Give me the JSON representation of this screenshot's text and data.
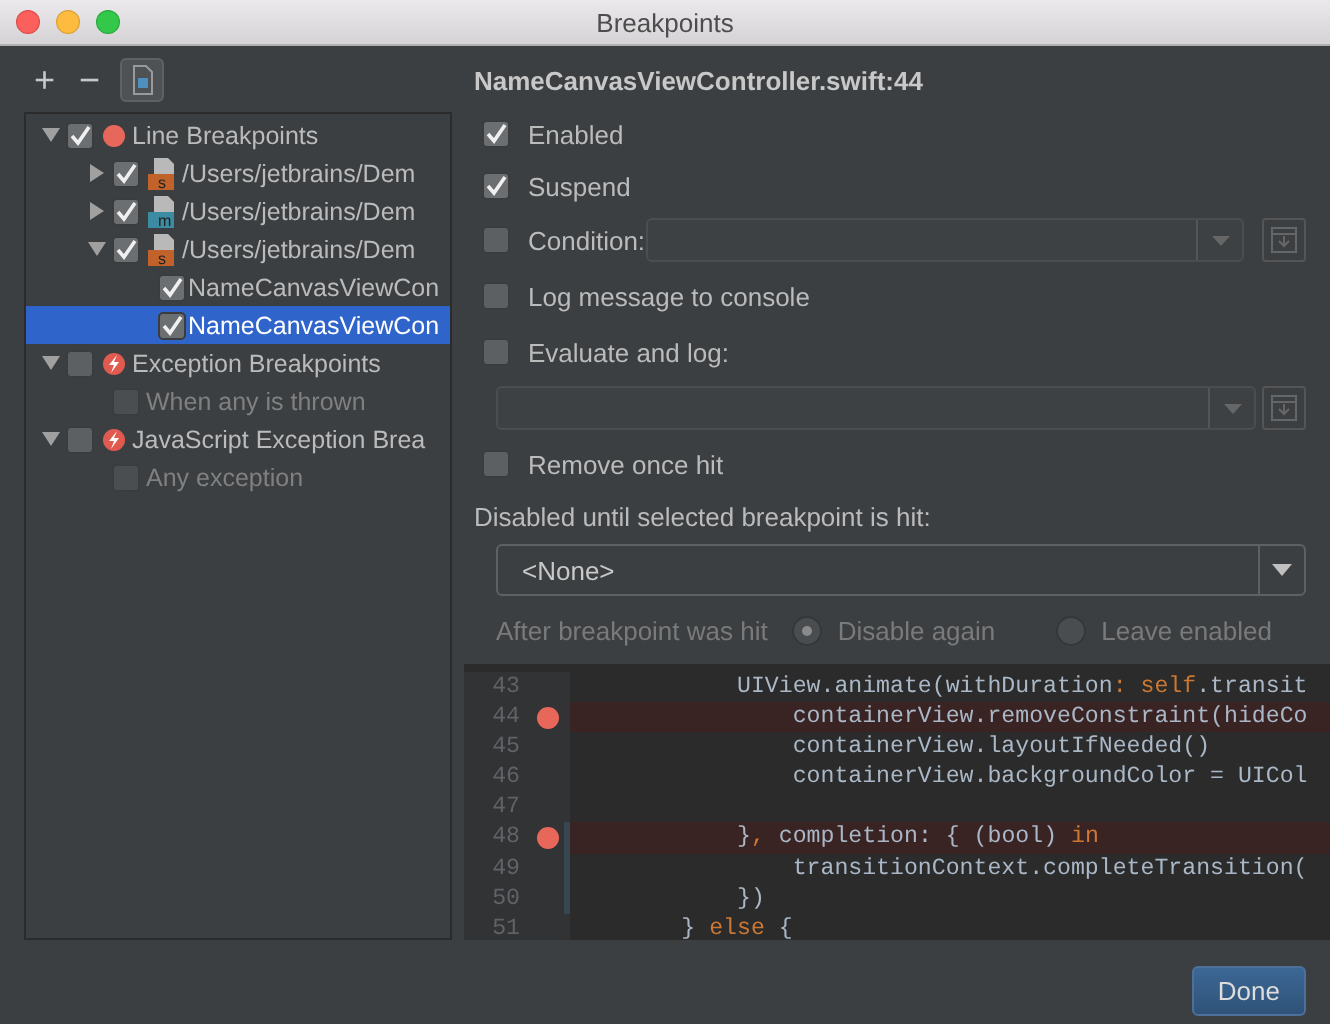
{
  "window": {
    "title": "Breakpoints"
  },
  "toolbar": [
    {
      "kind": "add",
      "label": "+"
    },
    {
      "kind": "remove",
      "label": "−"
    },
    {
      "kind": "group",
      "selected": true
    }
  ],
  "tree": [
    {
      "kind": "line-group",
      "label": "Line Breakpoints",
      "checked": true,
      "expanded": true,
      "selected": false,
      "disabled": false,
      "children": [
        {
          "kind": "file",
          "letter": "s",
          "color": "#c0622a",
          "label": "/Users/jetbrains/Dem",
          "checked": true,
          "expanded": false,
          "selected": false,
          "disabled": false
        },
        {
          "kind": "file",
          "letter": "m",
          "color": "#3b8ca3",
          "label": "/Users/jetbrains/Dem",
          "checked": true,
          "expanded": false,
          "selected": false,
          "disabled": false
        },
        {
          "kind": "file",
          "letter": "s",
          "color": "#c0622a",
          "label": "/Users/jetbrains/Dem",
          "checked": true,
          "expanded": true,
          "selected": false,
          "disabled": false,
          "children": [
            {
              "kind": "breakpoint",
              "label": "NameCanvasViewCon",
              "checked": true,
              "selected": false,
              "disabled": false
            },
            {
              "kind": "breakpoint",
              "label": "NameCanvasViewCon",
              "checked": true,
              "selected": true,
              "disabled": false
            }
          ]
        }
      ]
    },
    {
      "kind": "exception-group",
      "label": "Exception Breakpoints",
      "checked": false,
      "expanded": true,
      "selected": false,
      "disabled": false,
      "children": [
        {
          "kind": "option",
          "label": "When any is thrown",
          "checked": false,
          "selected": false,
          "disabled": true
        }
      ]
    },
    {
      "kind": "exception-group",
      "label": "JavaScript Exception Brea",
      "checked": false,
      "expanded": true,
      "selected": false,
      "disabled": false,
      "children": [
        {
          "kind": "option",
          "label": "Any exception",
          "checked": false,
          "selected": false,
          "disabled": true
        }
      ]
    }
  ],
  "details": {
    "title": "NameCanvasViewController.swift:44",
    "options": [
      {
        "kind": "check",
        "label": "Enabled",
        "checked": true
      },
      {
        "kind": "check",
        "label": "Suspend",
        "checked": true
      },
      {
        "kind": "field",
        "label": "Condition:",
        "checked": false
      },
      {
        "kind": "check",
        "label": "Log message to console",
        "checked": false
      },
      {
        "kind": "field-below",
        "label": "Evaluate and log:",
        "checked": false
      },
      {
        "kind": "check",
        "label": "Remove once hit",
        "checked": false
      }
    ],
    "dependency": {
      "label": "Disabled until selected breakpoint is hit:",
      "value": "<None>",
      "after_label": "After breakpoint was hit",
      "disabled": true,
      "radios": [
        {
          "label": "Disable again",
          "selected": true
        },
        {
          "label": "Leave enabled",
          "selected": false
        }
      ]
    }
  },
  "code": {
    "lines": [
      {
        "number": "43",
        "breakpoint": false,
        "changed": false,
        "segments": [
          {
            "kind": "plain",
            "text": "            UIView.animate(withDuration"
          },
          {
            "kind": "keyword",
            "text": ": self"
          },
          {
            "kind": "plain",
            "text": ".transit"
          }
        ]
      },
      {
        "number": "44",
        "breakpoint": true,
        "changed": false,
        "segments": [
          {
            "kind": "plain",
            "text": "                containerView.removeConstraint(hideCo"
          }
        ]
      },
      {
        "number": "45",
        "breakpoint": false,
        "changed": false,
        "segments": [
          {
            "kind": "plain",
            "text": "                containerView.layoutIfNeeded()"
          }
        ]
      },
      {
        "number": "46",
        "breakpoint": false,
        "changed": false,
        "segments": [
          {
            "kind": "plain",
            "text": "                containerView.backgroundColor = UICol"
          }
        ]
      },
      {
        "number": "47",
        "breakpoint": false,
        "changed": false
      },
      {
        "number": "48",
        "breakpoint": true,
        "changed": true,
        "segments": [
          {
            "kind": "plain",
            "text": "            }"
          },
          {
            "kind": "keyword",
            "text": ","
          },
          {
            "kind": "plain",
            "text": " completion: { (bool) "
          },
          {
            "kind": "keyword",
            "text": "in"
          }
        ]
      },
      {
        "number": "49",
        "breakpoint": false,
        "changed": true,
        "segments": [
          {
            "kind": "plain",
            "text": "                transitionContext.completeTransition("
          }
        ]
      },
      {
        "number": "50",
        "breakpoint": false,
        "changed": true,
        "segments": [
          {
            "kind": "plain",
            "text": "            })"
          }
        ]
      },
      {
        "number": "51",
        "breakpoint": false,
        "changed": false,
        "segments": [
          {
            "kind": "plain",
            "text": "        } "
          },
          {
            "kind": "keyword",
            "text": "else"
          },
          {
            "kind": "plain",
            "text": " {"
          }
        ]
      }
    ]
  },
  "buttons": [
    {
      "label": "Done",
      "default": true
    }
  ]
}
